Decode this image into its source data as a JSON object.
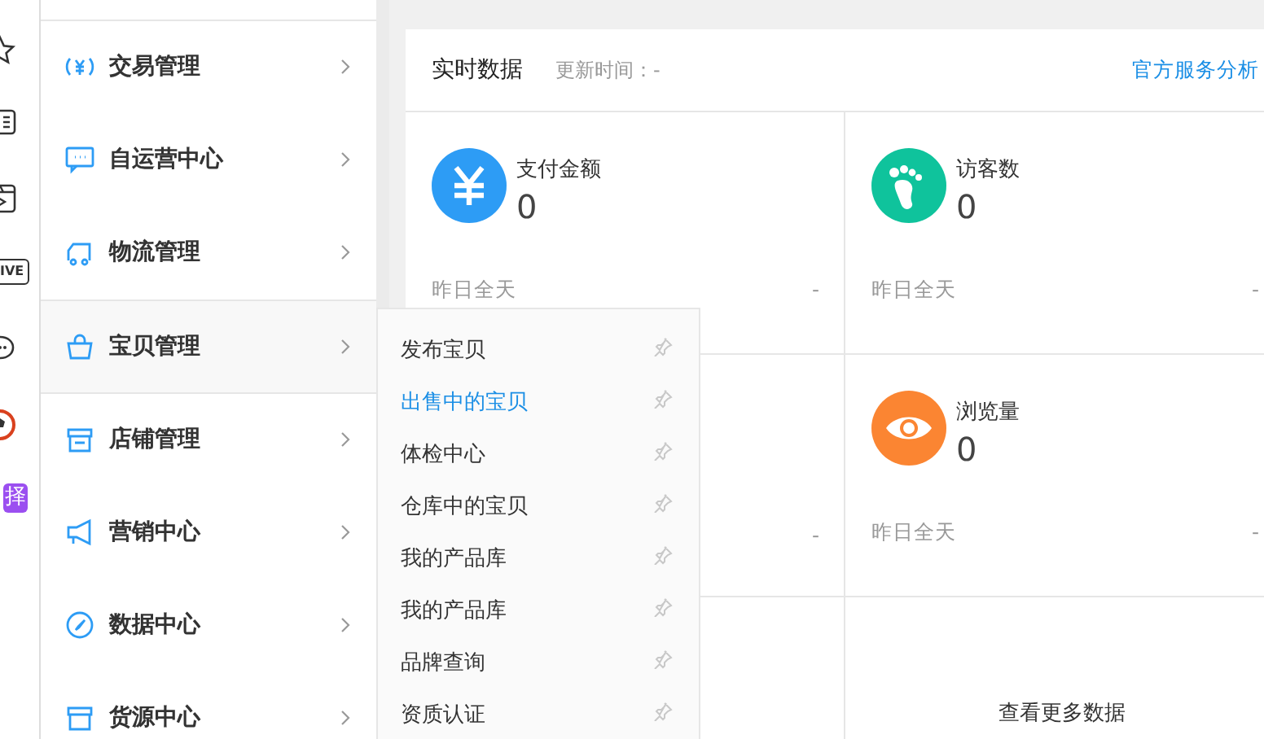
{
  "left_toolbar": [
    {
      "kind": "star"
    },
    {
      "kind": "card"
    },
    {
      "kind": "video"
    },
    {
      "kind": "live",
      "label": "IVE"
    },
    {
      "kind": "chat"
    },
    {
      "kind": "ball"
    },
    {
      "kind": "badge",
      "label": "择"
    }
  ],
  "sidebar": {
    "items": [
      {
        "label": "交易管理",
        "selected": false
      },
      {
        "label": "自运营中心",
        "selected": false
      },
      {
        "label": "物流管理",
        "selected": false
      },
      {
        "label": "宝贝管理",
        "selected": true
      },
      {
        "label": "店铺管理",
        "selected": false
      },
      {
        "label": "营销中心",
        "selected": false
      },
      {
        "label": "数据中心",
        "selected": false
      },
      {
        "label": "货源中心",
        "selected": false
      }
    ]
  },
  "flyout": {
    "items": [
      {
        "label": "发布宝贝",
        "selected": false
      },
      {
        "label": "出售中的宝贝",
        "selected": true
      },
      {
        "label": "体检中心",
        "selected": false
      },
      {
        "label": "仓库中的宝贝",
        "selected": false
      },
      {
        "label": "我的产品库",
        "selected": false
      },
      {
        "label": "我的产品库",
        "selected": false
      },
      {
        "label": "品牌查询",
        "selected": false
      },
      {
        "label": "资质认证",
        "selected": false
      }
    ]
  },
  "panel": {
    "title": "实时数据",
    "update_time": "更新时间：-",
    "link": "官方服务分析",
    "cells": [
      {
        "kind": "metric",
        "color": "#2d9cf5",
        "label": "支付金额",
        "value": "0",
        "footer_label": "昨日全天",
        "footer_value": "-"
      },
      {
        "kind": "metric",
        "color": "#0fc39c",
        "label": "访客数",
        "value": "0",
        "footer_label": "昨日全天",
        "footer_value": "-"
      },
      {
        "kind": "covered",
        "footer_value": "-"
      },
      {
        "kind": "metric",
        "color": "#fb8532",
        "label": "浏览量",
        "value": "0",
        "footer_label": "昨日全天",
        "footer_value": "-"
      },
      {
        "kind": "empty"
      },
      {
        "kind": "more",
        "label": "查看更多数据"
      }
    ]
  }
}
